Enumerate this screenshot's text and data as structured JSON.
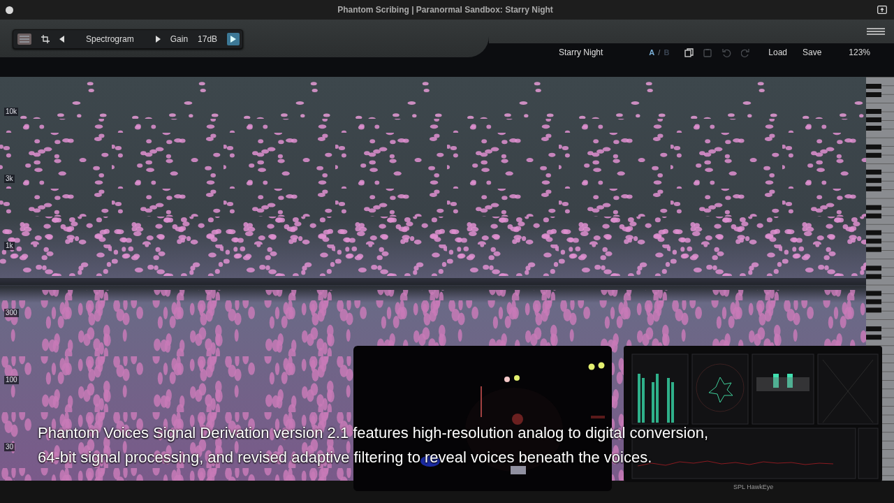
{
  "window": {
    "title": "Phantom Scribing | Paranormal Sandbox: Starry Night"
  },
  "toolbar": {
    "view": "Spectrogram",
    "gain_label": "Gain",
    "gain_value": "17dB",
    "play_active": true
  },
  "preset_bar": {
    "preset": "Starry Night",
    "separator": "/",
    "ab": [
      {
        "label": "A",
        "selected": true
      },
      {
        "label": "B",
        "selected": false
      }
    ],
    "tools": [
      {
        "kind": "copy",
        "disabled": false
      },
      {
        "kind": "paste",
        "disabled": true
      },
      {
        "kind": "undo",
        "disabled": true
      },
      {
        "kind": "redo",
        "disabled": true
      }
    ],
    "buttons": [
      "Load",
      "Save"
    ],
    "zoom": "123%"
  },
  "spectrogram": {
    "freq_labels": [
      "10k",
      "3k",
      "1k",
      "300",
      "100",
      "30"
    ]
  },
  "analyzer": {
    "caption": "SPL HawkEye"
  },
  "subtitle": [
    "Phantom Voices Signal Derivation version 2.1 features high-resolution analog to digital conversion,",
    "64-bit signal processing, and revised adaptive filtering to reveal voices beneath the voices."
  ]
}
